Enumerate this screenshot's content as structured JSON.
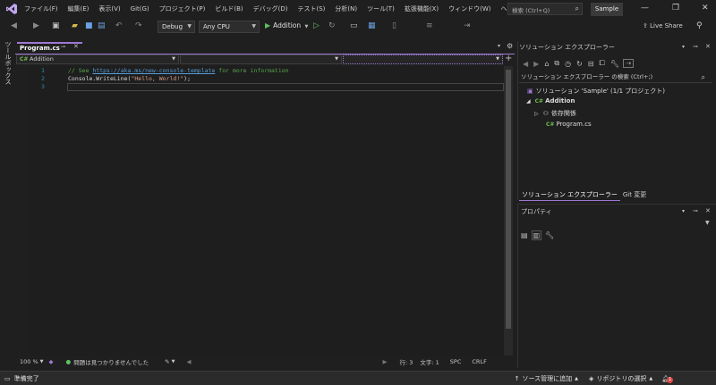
{
  "menu": [
    "ファイル(F)",
    "編集(E)",
    "表示(V)",
    "Git(G)",
    "プロジェクト(P)",
    "ビルド(B)",
    "デバッグ(D)",
    "テスト(S)",
    "分析(N)",
    "ツール(T)",
    "拡張機能(X)",
    "ウィンドウ(W)",
    "ヘルプ(H)"
  ],
  "search": {
    "placeholder": "検索 (Ctrl+Q)"
  },
  "solution_name_badge": "Sample",
  "toolbar": {
    "config": "Debug",
    "platform": "Any CPU",
    "run_label": "Addition",
    "live_share": "Live Share"
  },
  "toolbox_label": "ツールボックス",
  "editor": {
    "tab_title": "Program.cs",
    "nav_project": "Addition",
    "lines": [
      {
        "no": "1",
        "comment_pre": "// See ",
        "link": "https://aka.ms/new-console-template",
        "comment_post": " for more information"
      },
      {
        "no": "2",
        "code_pre": "Console.WriteLine(",
        "string": "\"Hello, World!\"",
        "code_post": ");"
      },
      {
        "no": "3"
      }
    ],
    "status": {
      "zoom": "100 %",
      "issues": "問題は見つかりませんでした",
      "line": "行: 3",
      "col": "文字: 1",
      "spc": "SPC",
      "crlf": "CRLF"
    }
  },
  "solution_explorer": {
    "title": "ソリューション エクスプローラー",
    "search_placeholder": "ソリューション エクスプローラー の検索 (Ctrl+;)",
    "solution": "ソリューション 'Sample' (1/1 プロジェクト)",
    "project": "Addition",
    "dependencies": "依存関係",
    "file": "Program.cs",
    "tabs": [
      "ソリューション エクスプローラー",
      "Git 変更"
    ]
  },
  "properties": {
    "title": "プロパティ"
  },
  "statusbar": {
    "ready": "準備完了",
    "add_source_control": "ソース管理に追加",
    "select_repo": "リポジトリの選択",
    "notification_count": "1"
  },
  "colors": {
    "accent": "#9d78d4",
    "run_green": "#5fbf5f",
    "comment": "#57a64a",
    "string": "#d69d85",
    "link": "#569cd6",
    "line_number": "#2b91af"
  }
}
